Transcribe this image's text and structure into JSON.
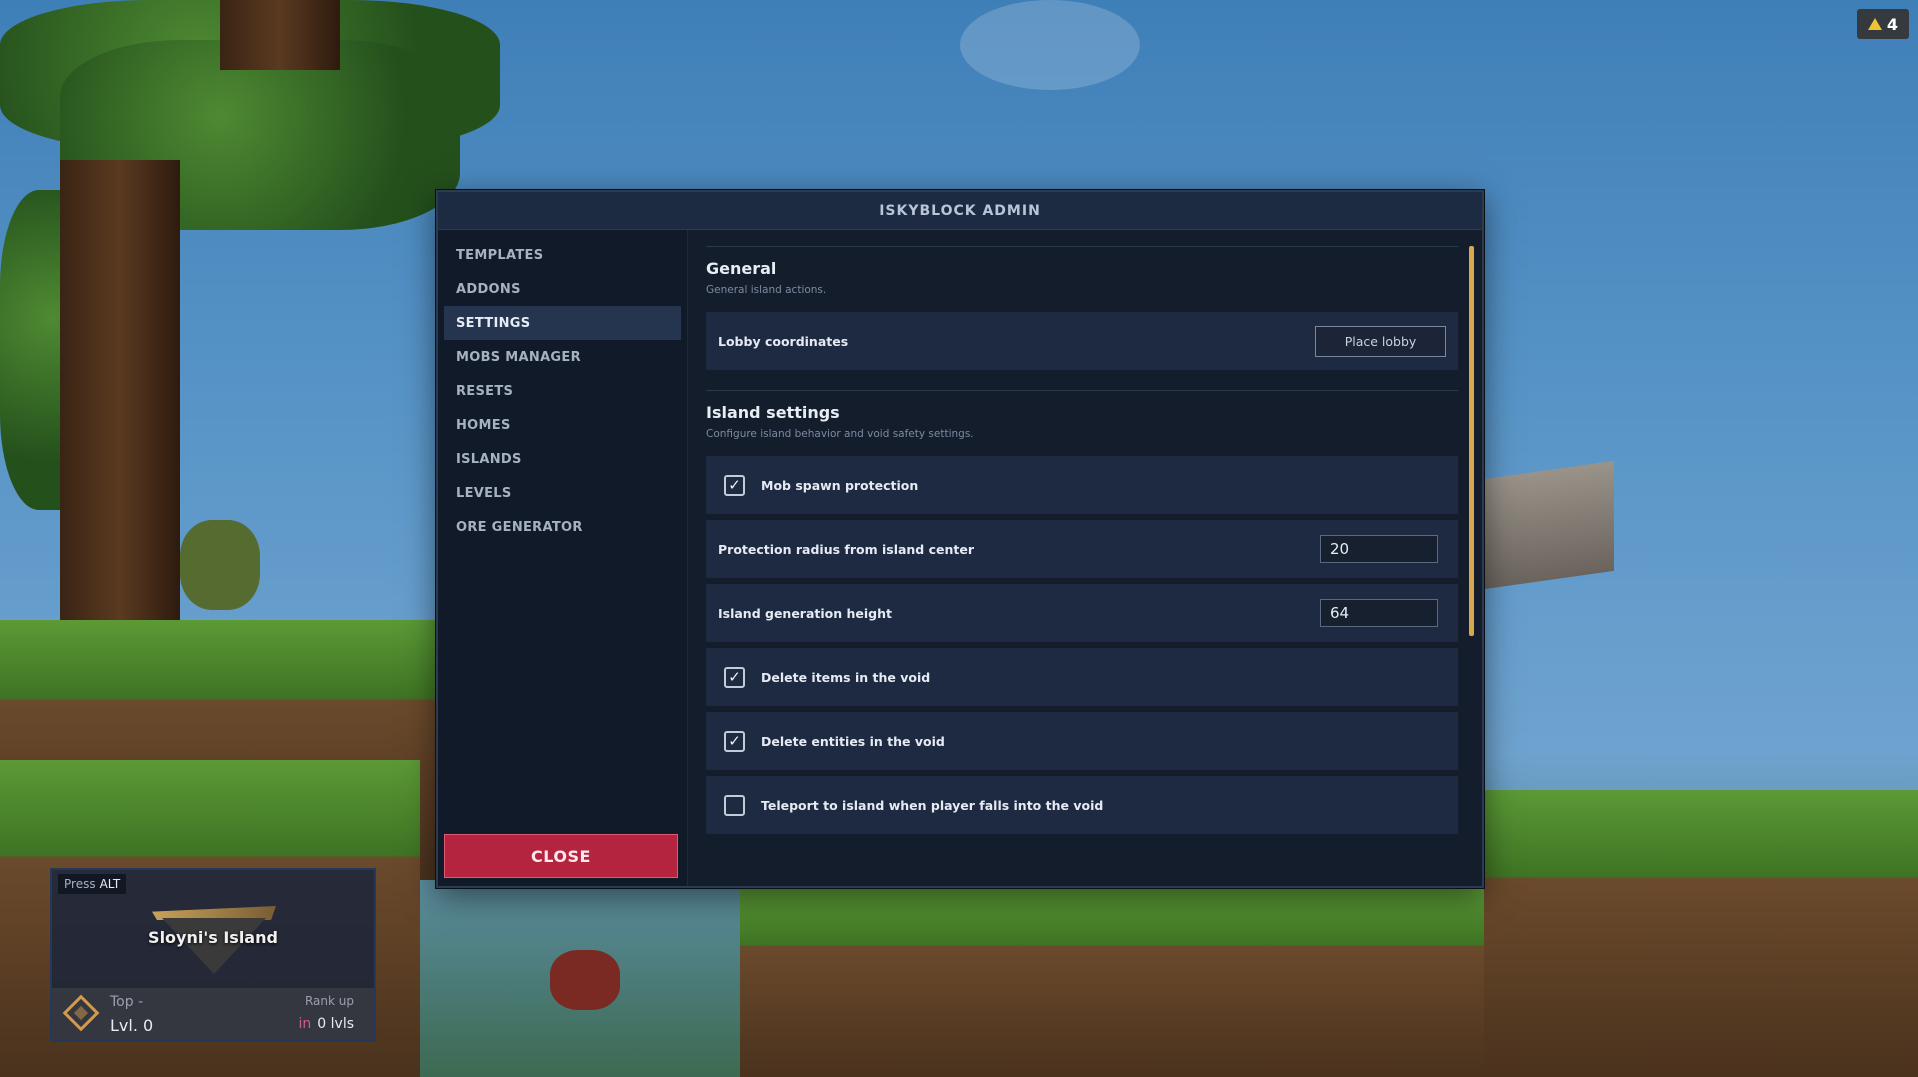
{
  "hud": {
    "warning_count": "4",
    "press_label": "Press",
    "press_key": "ALT",
    "island_name": "Sloyni's Island",
    "top_label": "Top -",
    "level_label": "Lvl. 0",
    "rank_label": "Rank up",
    "rank_in": "in",
    "rank_value": "0 lvls"
  },
  "dialog": {
    "title": "ISKYBLOCK ADMIN",
    "nav": [
      {
        "label": "TEMPLATES",
        "active": false
      },
      {
        "label": "ADDONS",
        "active": false
      },
      {
        "label": "SETTINGS",
        "active": true
      },
      {
        "label": "MOBS MANAGER",
        "active": false
      },
      {
        "label": "RESETS",
        "active": false
      },
      {
        "label": "HOMES",
        "active": false
      },
      {
        "label": "ISLANDS",
        "active": false
      },
      {
        "label": "LEVELS",
        "active": false
      },
      {
        "label": "ORE GENERATOR",
        "active": false
      }
    ],
    "close_label": "CLOSE",
    "general": {
      "title": "General",
      "description": "General island actions.",
      "lobby_label": "Lobby coordinates",
      "place_lobby_label": "Place lobby"
    },
    "island_settings": {
      "title": "Island settings",
      "description": "Configure island behavior and void safety settings.",
      "mob_spawn_label": "Mob spawn protection",
      "mob_spawn_checked": true,
      "radius_label": "Protection radius from island center",
      "radius_value": "20",
      "height_label": "Island generation height",
      "height_value": "64",
      "delete_items_label": "Delete items in the void",
      "delete_items_checked": true,
      "delete_entities_label": "Delete entities in the void",
      "delete_entities_checked": true,
      "teleport_label": "Teleport to island when player falls into the void",
      "teleport_checked": false
    }
  },
  "icons": {
    "check": "✓",
    "warning": "warning-icon",
    "rank": "diamond-icon"
  },
  "colors": {
    "dialog_bg": "#131d2c",
    "row_bg": "#1e2a42",
    "active_nav": "#26354f",
    "close_button": "#b4243e",
    "scrollbar": "#d8a84e",
    "warning": "#f1c232"
  }
}
